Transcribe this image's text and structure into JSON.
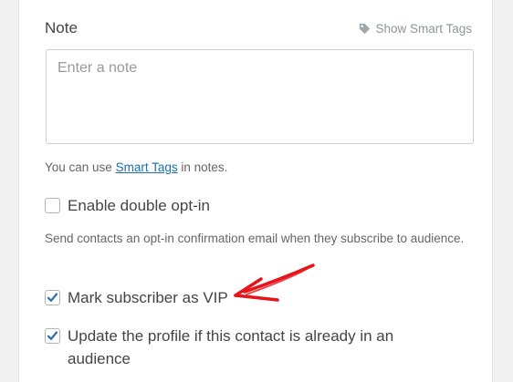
{
  "note": {
    "label": "Note",
    "smart_tags_toggle": "Show Smart Tags",
    "placeholder": "Enter a note",
    "value": "",
    "help_prefix": "You can use ",
    "help_link": "Smart Tags",
    "help_suffix": " in notes."
  },
  "double_optin": {
    "label": "Enable double opt-in",
    "checked": false,
    "description": "Send contacts an opt-in confirmation email when they subscribe to audience."
  },
  "vip": {
    "label": "Mark subscriber as VIP",
    "checked": true
  },
  "update_profile": {
    "label": "Update the profile if this contact is already in an audience",
    "checked": true
  },
  "annotation": {
    "arrow_color": "#e8141b"
  },
  "colors": {
    "checkmark": "#2a6fb0",
    "link": "#1d6fa8"
  }
}
